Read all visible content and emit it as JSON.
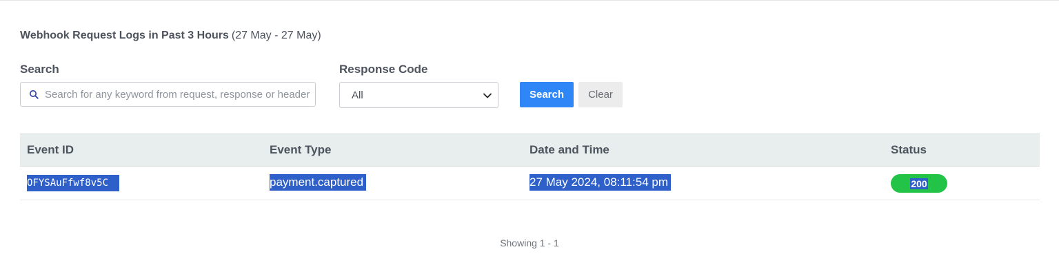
{
  "header": {
    "title": "Webhook Request Logs in Past 3 Hours",
    "range": "(27 May - 27 May)"
  },
  "filters": {
    "search_label": "Search",
    "search_placeholder": "Search for any keyword from request, response or headers",
    "search_value": "",
    "response_code_label": "Response Code",
    "response_code_selected": "All",
    "search_button": "Search",
    "clear_button": "Clear"
  },
  "table": {
    "columns": [
      "Event ID",
      "Event Type",
      "Date and Time",
      "Status"
    ],
    "rows": [
      {
        "event_id": "OFYSAuFfwf8v5C",
        "event_type": "payment.captured",
        "date_time": "27 May 2024, 08:11:54 pm",
        "status": "200"
      }
    ]
  },
  "pagination": {
    "text": "Showing 1 - 1"
  },
  "colors": {
    "primary": "#2f86f6",
    "status_success": "#23c347",
    "selection": "#2f5fc9",
    "header_bg": "#e8eeee"
  },
  "icons": {
    "search": "search-icon",
    "dropdown": "chevron-down-icon"
  }
}
